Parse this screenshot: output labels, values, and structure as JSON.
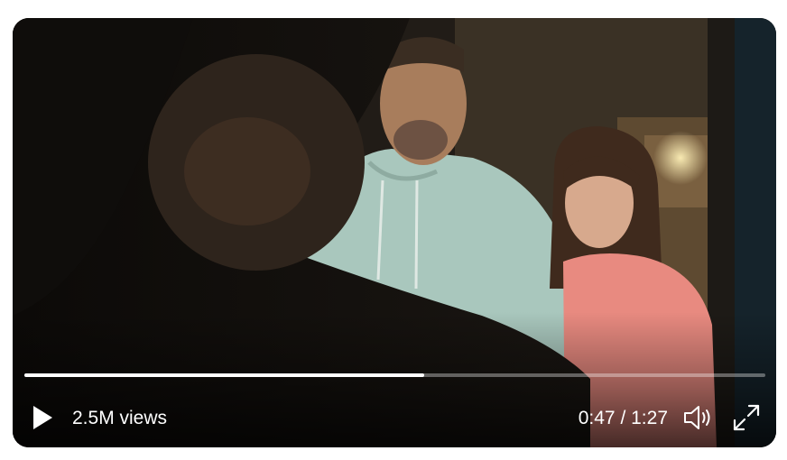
{
  "video": {
    "views_label": "2.5M views",
    "current_time": "0:47",
    "duration": "1:27",
    "progress_fraction": 0.54
  },
  "icons": {
    "play": "play-icon",
    "volume": "volume-icon",
    "fullscreen": "fullscreen-expand-icon"
  },
  "colors": {
    "controls": "#ffffff",
    "progress_track": "rgba(255,255,255,0.35)",
    "progress_fill": "#ffffff"
  }
}
